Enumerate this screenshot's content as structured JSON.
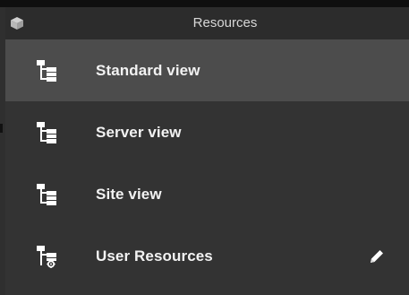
{
  "panel": {
    "title": "Resources",
    "header_icon": "cube-icon"
  },
  "resources": {
    "items": [
      {
        "label": "Standard view",
        "icon": "tree-view-icon",
        "selected": true
      },
      {
        "label": "Server view",
        "icon": "tree-view-icon",
        "selected": false
      },
      {
        "label": "Site view",
        "icon": "tree-view-icon",
        "selected": false
      },
      {
        "label": "User Resources",
        "icon": "tree-view-gear-icon",
        "selected": false,
        "action_icon": "pencil-icon"
      }
    ]
  },
  "colors": {
    "background": "#333333",
    "header_background": "#2c2c2c",
    "selected_background": "#4c4c4c",
    "text": "#f2f2f2",
    "icon": "#ffffff"
  }
}
